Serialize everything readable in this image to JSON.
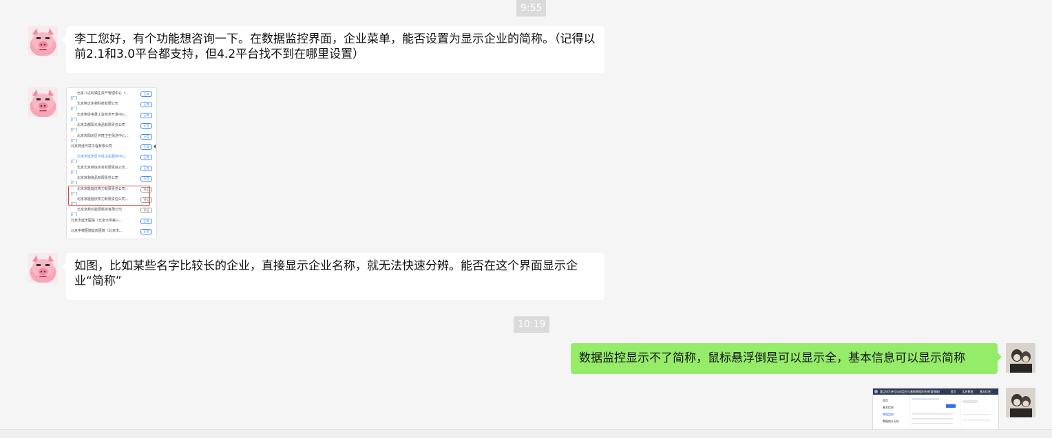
{
  "timestamps": [
    "9:55",
    "10:19"
  ],
  "messages": [
    {
      "side": "left",
      "text": "李工您好，有个功能想咨询一下。在数据监控界面，企业菜单，能否设置为显示企业的简称。（记得以前2.1和3.0平台都支持，但4.2平台找不到在哪里设置）"
    },
    {
      "side": "left",
      "text": "如图，比如某些名字比较长的企业，直接显示企业名称，就无法快速分辨。能否在这个界面显示企业“简称”"
    },
    {
      "side": "right",
      "text": "数据监控显示不了简称，鼠标悬浮倒是可以显示全，基本信息可以显示简称"
    }
  ],
  "screenshot_list": {
    "rows": [
      {
        "text": "北京八达岭镇生资产管理中心（...",
        "badge": "正常",
        "prefix": true,
        "blue": false
      },
      {
        "text": "北京燕正生物科技有限公司",
        "badge": "正常",
        "prefix": true,
        "blue": false
      },
      {
        "text": "北京燕住宅重工业技术开发中心...",
        "badge": "正常",
        "prefix": true,
        "blue": false
      },
      {
        "text": "北京华都阳光食品有限责任公司",
        "badge": "正常",
        "prefix": true,
        "blue": false
      },
      {
        "text": "北京市阳坊区环境卫生保洁中心...",
        "badge": "正常",
        "prefix": true,
        "blue": false
      },
      {
        "text": "北京燕佳环境工程有限公司",
        "badge": "正常",
        "prefix": false,
        "blue": false
      },
      {
        "text": "北京市延庆区环境卫生服务中心...",
        "badge": "正常",
        "prefix": true,
        "blue": true
      },
      {
        "text": "北京北京燕信水务有限责任公司...",
        "badge": "正常",
        "prefix": true,
        "blue": false
      },
      {
        "text": "北京京和食品有限责任公司",
        "badge": "正常",
        "prefix": true,
        "blue": false
      },
      {
        "text": "北京京能延庆热力有限责任公司...",
        "badge": "停运",
        "prefix": true,
        "blue": false
      },
      {
        "text": "北京京能延庆热力有限责任公司...",
        "badge": "停运",
        "prefix": true,
        "blue": false
      },
      {
        "text": "北京京燕北能源科技有限公司",
        "badge": "停运",
        "prefix": true,
        "blue": false
      },
      {
        "text": "北京市延庆医院（北京大学第三...",
        "badge": "正常",
        "prefix": false,
        "blue": false
      },
      {
        "text": "北京中德医院延庆医院（北京市...",
        "badge": "正常",
        "prefix": false,
        "blue": false
      }
    ],
    "prefix_label": "[厂]"
  },
  "thumb2": {
    "title": "重点排污单位自动监控与基础数据库系统(管理端)",
    "tabs": [
      "首页",
      "实时数据",
      "基本信息"
    ],
    "sidebar": [
      "首页",
      "基本信息",
      "数据监控",
      "数据统计分析"
    ]
  },
  "colors": {
    "bg": "#f5f5f5",
    "bubble_right": "#95ec69",
    "bubble_left": "#ffffff",
    "highlight": "#e0463c"
  }
}
